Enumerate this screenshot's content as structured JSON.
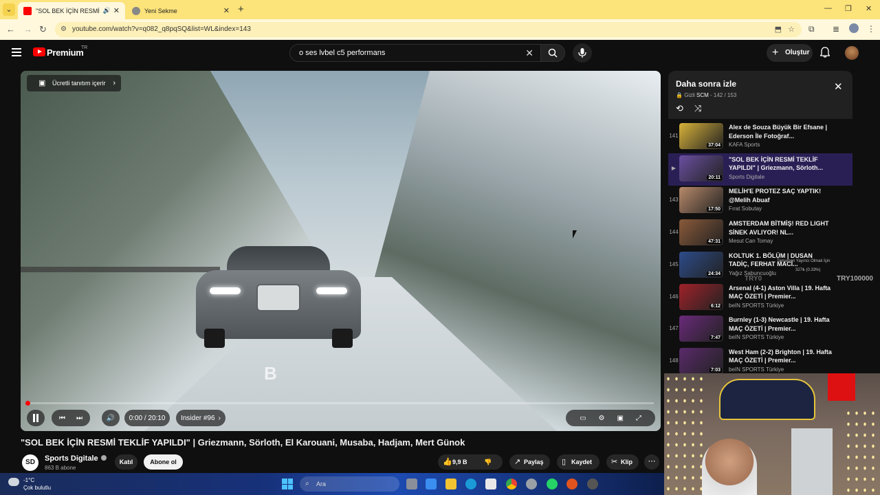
{
  "browser": {
    "tabs": [
      {
        "title": "\"SOL BEK İÇİN RESMİ TEKLİ",
        "active": true
      },
      {
        "title": "Yeni Sekme",
        "active": false
      }
    ],
    "url": "youtube.com/watch?v=q082_q8pqSQ&list=WL&index=143"
  },
  "header": {
    "brand": "Premium",
    "region": "TR",
    "search_query": "o ses lvbel c5 performans",
    "create_label": "Oluştur"
  },
  "player": {
    "paid_promo": "Ücretli tanıtım içerir",
    "time": "0:00 / 20:10",
    "chapter": "Insider #96",
    "watermark": "B",
    "progress": 0.003
  },
  "video": {
    "title": "\"SOL BEK İÇİN RESMİ TEKLİF YAPILDI\" | Griezmann, Sörloth, El Karouani, Musaba, Hadjam, Mert Günok",
    "channel": "Sports Digitale",
    "channel_logo_text": "SD",
    "subscribers": "863 B abone",
    "join_label": "Katıl",
    "subscribe_label": "Abone ol",
    "likes": "9,9 B",
    "share_label": "Paylaş",
    "save_label": "Kaydet",
    "clip_label": "Klip"
  },
  "playlist": {
    "title": "Daha sonra izle",
    "privacy": "Gizli",
    "owner": "SCM",
    "position": "142 / 153",
    "items": [
      {
        "index": "141",
        "title": "Alex de Souza Büyük Bir Efsane | Ederson İle Fotoğraf...",
        "channel": "KAFA Sports",
        "duration": "37:04",
        "color": "#d8b23a"
      },
      {
        "index": "▶",
        "title": "\"SOL BEK İÇİN RESMİ TEKLİF YAPILDI\" | Griezmann, Sörloth...",
        "channel": "Sports Digitale",
        "duration": "20:11",
        "color": "#6b4fa0"
      },
      {
        "index": "143",
        "title": "MELİH'E PROTEZ SAÇ YAPTIK! @Melih Abuaf",
        "channel": "Fırat Sobutay",
        "duration": "17:50",
        "color": "#b88a6a"
      },
      {
        "index": "144",
        "title": "AMSTERDAM BİTMİŞ! RED LIGHT SİNEK AVLIYOR! NL...",
        "channel": "Mesut Can Tomay",
        "duration": "47:31",
        "color": "#8a5a3a"
      },
      {
        "index": "145",
        "title": "KOLTUK 1. BÖLÜM | DUSAN TADİÇ, FERHAT MACİ...",
        "channel": "Yağız Sabuncuoğlu",
        "duration": "24:34",
        "color": "#2d4c8a"
      },
      {
        "index": "146",
        "title": "Arsenal (4-1) Aston Villa | 19. Hafta MAÇ ÖZETİ | Premier...",
        "channel": "beIN SPORTS Türkiye",
        "duration": "6:12",
        "color": "#a0222a"
      },
      {
        "index": "147",
        "title": "Burnley (1-3) Newcastle | 19. Hafta MAÇ ÖZETİ | Premier...",
        "channel": "beIN SPORTS Türkiye",
        "duration": "7:47",
        "color": "#6a2a7a"
      },
      {
        "index": "148",
        "title": "West Ham (2-2) Brighton | 19. Hafta MAÇ ÖZETİ | Premier...",
        "channel": "beIN SPORTS Türkiye",
        "duration": "7:03",
        "color": "#5a2a6a"
      }
    ]
  },
  "overlay": {
    "goal_label": "Tamamen Yayıncı Olmak İçin",
    "goal_progress": "327₺ (0.33%)",
    "currency_left": "TRY0",
    "currency_right": "TRY100000"
  },
  "taskbar": {
    "temperature": "-1°C",
    "weather": "Çok bulutlu",
    "search_label": "Ara"
  }
}
